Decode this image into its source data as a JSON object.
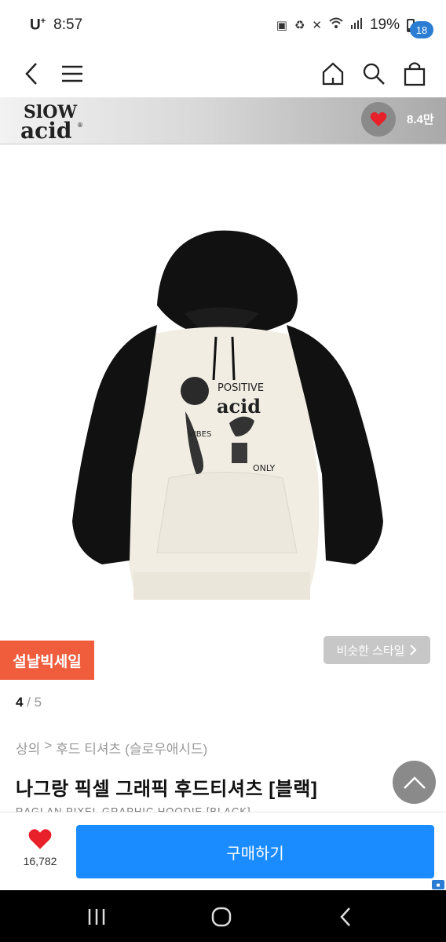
{
  "status_bar": {
    "carrier": "U",
    "carrier_sup": "+",
    "time": "8:57",
    "battery": "19%"
  },
  "nav": {
    "cart_count": "18",
    "icons": [
      "chevron-left-icon",
      "hamburger-menu-icon",
      "home-icon",
      "search-icon",
      "shopping-bag-icon"
    ]
  },
  "brand": {
    "logo_text": "SLOW acid",
    "like_count": "8.4만"
  },
  "product": {
    "sale_badge": "설날빅세일",
    "similar_style": "비슷한 스타일",
    "page_current": "4",
    "page_sep": "/",
    "page_total": "5",
    "breadcrumb": [
      "상의",
      ">",
      "후드 티셔츠",
      "(슬로우애시드)"
    ],
    "title": "나그랑 픽셀 그래픽 후드티셔츠 [블랙]",
    "subtitle": "RAGLAN PIXEL GRAPHIC HOODIE [BLACK]",
    "print": {
      "line1": "POSITIVE",
      "line2": "acid",
      "line3": "VIBES",
      "line4": "ONLY"
    }
  },
  "action_bar": {
    "like_count": "16,782",
    "buy_label": "구매하기"
  },
  "colors": {
    "buy_button": "#1a8cff",
    "sale_badge": "#f05d3c",
    "cart_badge": "#2b7cd3",
    "heart": "#e8202a"
  }
}
